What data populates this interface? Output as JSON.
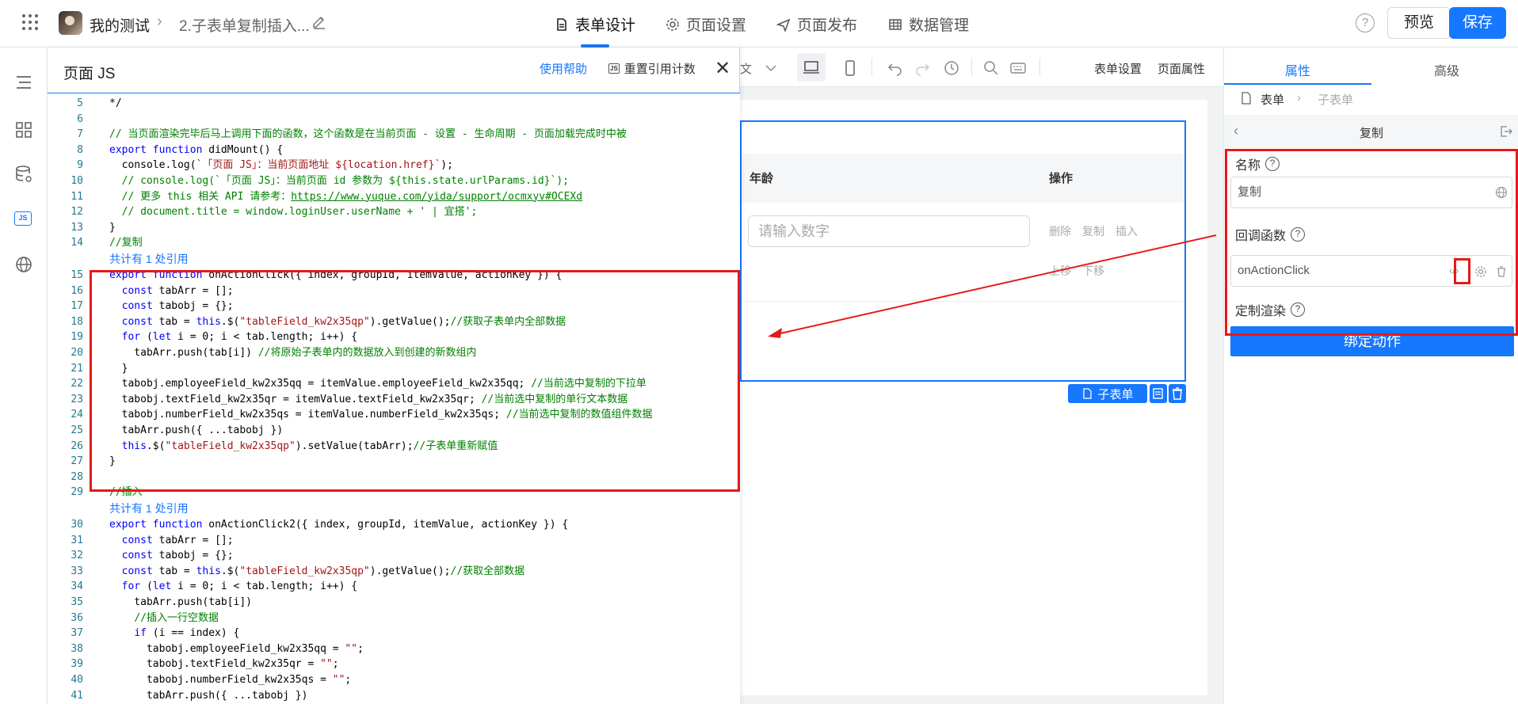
{
  "topbar": {
    "app_name": "我的测试",
    "page_name": "2.子表单复制插入...",
    "tabs": [
      {
        "label": "表单设计",
        "icon": "doc-icon",
        "active": true
      },
      {
        "label": "页面设置",
        "icon": "gear-icon"
      },
      {
        "label": "页面发布",
        "icon": "send-icon"
      },
      {
        "label": "数据管理",
        "icon": "table-icon"
      }
    ],
    "preview_label": "预览",
    "save_label": "保存",
    "help_label": "?"
  },
  "jspanel": {
    "title": "页面 JS",
    "help_link": "使用帮助",
    "reset_label": "重置引用计数",
    "js_badge": "JS",
    "close": "✕"
  },
  "code": {
    "ref_note_1": "共计有 1 处引用",
    "ref_note_2": "共计有 1 处引用",
    "lines": [
      {
        "n": "5",
        "t": "*/"
      },
      {
        "n": "6",
        "t": ""
      },
      {
        "n": "7",
        "t": "// 当页面渲染完毕后马上调用下面的函数，这个函数是在当前页面 - 设置 - 生命周期 - 页面加载完成时中被"
      },
      {
        "n": "8",
        "t": "export function didMount() {"
      },
      {
        "n": "9",
        "t": "  console.log(`「页面 JS」：当前页面地址 ${location.href}`);"
      },
      {
        "n": "10",
        "t": "  // console.log(`「页面 JS」：当前页面 id 参数为 ${this.state.urlParams.id}`);"
      },
      {
        "n": "11",
        "t": "  // 更多 this 相关 API 请参考：https://www.yuque.com/yida/support/ocmxyv#OCEXd"
      },
      {
        "n": "12",
        "t": "  // document.title = window.loginUser.userName + ' | 宜搭';"
      },
      {
        "n": "13",
        "t": "}"
      },
      {
        "n": "14",
        "t": "//复制"
      },
      {
        "n": "15",
        "t": "export function onActionClick({ index, groupId, itemValue, actionKey }) {"
      },
      {
        "n": "16",
        "t": "  const tabArr = [];"
      },
      {
        "n": "17",
        "t": "  const tabobj = {};"
      },
      {
        "n": "18",
        "t": "  const tab = this.$(\"tableField_kw2x35qp\").getValue();//获取子表单内全部数据"
      },
      {
        "n": "19",
        "t": "  for (let i = 0; i < tab.length; i++) {"
      },
      {
        "n": "20",
        "t": "    tabArr.push(tab[i]) //将原始子表单内的数据放入到创建的新数组内"
      },
      {
        "n": "21",
        "t": "  }"
      },
      {
        "n": "22",
        "t": "  tabobj.employeeField_kw2x35qq = itemValue.employeeField_kw2x35qq; //当前选中复制的下拉单"
      },
      {
        "n": "23",
        "t": "  tabobj.textField_kw2x35qr = itemValue.textField_kw2x35qr; //当前选中复制的单行文本数据"
      },
      {
        "n": "24",
        "t": "  tabobj.numberField_kw2x35qs = itemValue.numberField_kw2x35qs; //当前选中复制的数值组件数据"
      },
      {
        "n": "25",
        "t": "  tabArr.push({ ...tabobj })"
      },
      {
        "n": "26",
        "t": "  this.$(\"tableField_kw2x35qp\").setValue(tabArr);//子表单重新赋值"
      },
      {
        "n": "27",
        "t": "}"
      },
      {
        "n": "28",
        "t": ""
      },
      {
        "n": "29",
        "t": "//插入"
      },
      {
        "n": "30",
        "t": "export function onActionClick2({ index, groupId, itemValue, actionKey }) {"
      },
      {
        "n": "31",
        "t": "  const tabArr = [];"
      },
      {
        "n": "32",
        "t": "  const tabobj = {};"
      },
      {
        "n": "33",
        "t": "  const tab = this.$(\"tableField_kw2x35qp\").getValue();//获取全部数据"
      },
      {
        "n": "34",
        "t": "  for (let i = 0; i < tab.length; i++) {"
      },
      {
        "n": "35",
        "t": "    tabArr.push(tab[i])"
      },
      {
        "n": "36",
        "t": "    //插入一行空数据"
      },
      {
        "n": "37",
        "t": "    if (i == index) {"
      },
      {
        "n": "38",
        "t": "      tabobj.employeeField_kw2x35qq = \"\";"
      },
      {
        "n": "39",
        "t": "      tabobj.textField_kw2x35qr = \"\";"
      },
      {
        "n": "40",
        "t": "      tabobj.numberField_kw2x35qs = \"\";"
      },
      {
        "n": "41",
        "t": "      tabArr.push({ ...tabobj })"
      }
    ]
  },
  "canvas_toolbar": {
    "form_settings": "表单设置",
    "page_props": "页面属性",
    "partial_char": "文"
  },
  "subtable": {
    "col_age": "年龄",
    "col_ops": "操作",
    "number_placeholder": "请输入数字",
    "ops_row1": [
      "删除",
      "复制",
      "插入"
    ],
    "ops_row2": [
      "上移",
      "下移"
    ],
    "badge_label": "子表单"
  },
  "props": {
    "tab_props": "属性",
    "tab_advanced": "高级",
    "crumb_root": "表单",
    "crumb_leaf": "子表单",
    "action_title": "复制",
    "name_label": "名称",
    "name_value": "复制",
    "callback_label": "回调函数",
    "callback_value": "onActionClick",
    "custom_render_label": "定制渲染",
    "bind_button": "绑定动作"
  },
  "colors": {
    "accent": "#1677ff",
    "highlight": "#e61919"
  }
}
